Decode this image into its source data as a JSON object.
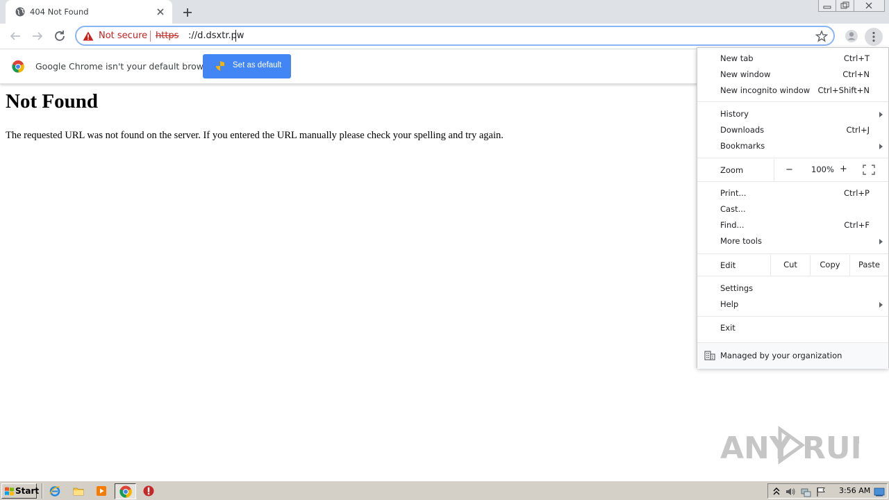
{
  "tab": {
    "title": "404 Not Found"
  },
  "omnibox": {
    "security_label": "Not secure",
    "url_scheme": "https",
    "url_rest": "://d.dsxtr.pw"
  },
  "infobar": {
    "message": "Google Chrome isn't your default browser",
    "button_label": "Set as default"
  },
  "page": {
    "heading": "Not Found",
    "body": "The requested URL was not found on the server. If you entered the URL manually please check your spelling and try again."
  },
  "menu": {
    "new_tab": {
      "label": "New tab",
      "shortcut": "Ctrl+T"
    },
    "new_window": {
      "label": "New window",
      "shortcut": "Ctrl+N"
    },
    "new_incognito": {
      "label": "New incognito window",
      "shortcut": "Ctrl+Shift+N"
    },
    "history": {
      "label": "History"
    },
    "downloads": {
      "label": "Downloads",
      "shortcut": "Ctrl+J"
    },
    "bookmarks": {
      "label": "Bookmarks"
    },
    "zoom": {
      "label": "Zoom",
      "minus": "−",
      "value": "100%",
      "plus": "+"
    },
    "print": {
      "label": "Print...",
      "shortcut": "Ctrl+P"
    },
    "cast": {
      "label": "Cast..."
    },
    "find": {
      "label": "Find...",
      "shortcut": "Ctrl+F"
    },
    "more_tools": {
      "label": "More tools"
    },
    "edit": {
      "label": "Edit",
      "cut": "Cut",
      "copy": "Copy",
      "paste": "Paste"
    },
    "settings": {
      "label": "Settings"
    },
    "help": {
      "label": "Help"
    },
    "exit": {
      "label": "Exit"
    },
    "managed": {
      "label": "Managed by your organization"
    }
  },
  "watermark": {
    "text_left": "ANY",
    "text_right": "RUN"
  },
  "taskbar": {
    "start_label": "Start",
    "clock": "3:56 AM"
  },
  "colors": {
    "accent_blue": "#4285f4",
    "insecure_red": "#c5221f",
    "tabstrip_gray": "#dee1e6"
  }
}
